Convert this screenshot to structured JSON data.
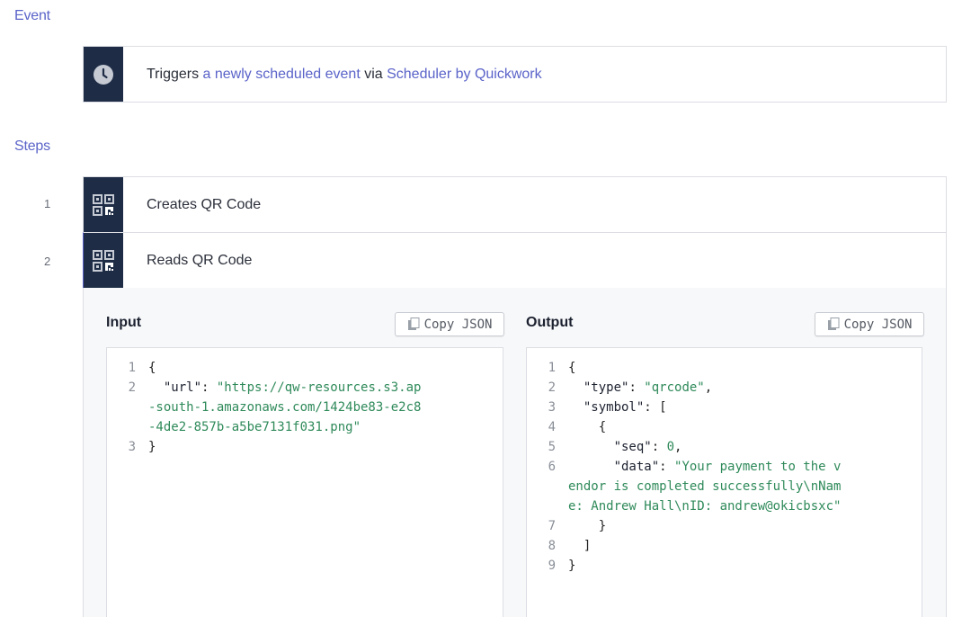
{
  "event_section": {
    "heading": "Event",
    "trigger": {
      "prefix": "Triggers ",
      "event_link": "a newly scheduled event",
      "middle": " via ",
      "app_link": "Scheduler by Quickwork",
      "icon": "clock-icon"
    }
  },
  "steps_section": {
    "heading": "Steps",
    "steps": [
      {
        "number": "1",
        "label": "Creates QR Code",
        "icon": "qr-code-icon"
      },
      {
        "number": "2",
        "label": "Reads QR Code",
        "icon": "qr-code-icon"
      }
    ]
  },
  "detail": {
    "input": {
      "title": "Input",
      "copy_label": "Copy JSON",
      "lines": [
        {
          "n": "1",
          "parts": [
            [
              "p",
              "{"
            ]
          ]
        },
        {
          "n": "2",
          "parts": [
            [
              "p",
              "  "
            ],
            [
              "k",
              "\"url\""
            ],
            [
              "p",
              ": "
            ],
            [
              "s",
              "\"https://qw-resources.s3.ap"
            ]
          ]
        },
        {
          "n": "",
          "parts": [
            [
              "s",
              "-south-1.amazonaws.com/1424be83-e2c8"
            ]
          ]
        },
        {
          "n": "",
          "parts": [
            [
              "s",
              "-4de2-857b-a5be7131f031.png\""
            ]
          ]
        },
        {
          "n": "3",
          "parts": [
            [
              "p",
              "}"
            ]
          ]
        }
      ]
    },
    "output": {
      "title": "Output",
      "copy_label": "Copy JSON",
      "lines": [
        {
          "n": "1",
          "parts": [
            [
              "p",
              "{"
            ]
          ]
        },
        {
          "n": "2",
          "parts": [
            [
              "p",
              "  "
            ],
            [
              "k",
              "\"type\""
            ],
            [
              "p",
              ": "
            ],
            [
              "s",
              "\"qrcode\""
            ],
            [
              "p",
              ","
            ]
          ]
        },
        {
          "n": "3",
          "parts": [
            [
              "p",
              "  "
            ],
            [
              "k",
              "\"symbol\""
            ],
            [
              "p",
              ": ["
            ]
          ]
        },
        {
          "n": "4",
          "parts": [
            [
              "p",
              "    {"
            ]
          ]
        },
        {
          "n": "5",
          "parts": [
            [
              "p",
              "      "
            ],
            [
              "k",
              "\"seq\""
            ],
            [
              "p",
              ": "
            ],
            [
              "m",
              "0"
            ],
            [
              "p",
              ","
            ]
          ]
        },
        {
          "n": "6",
          "parts": [
            [
              "p",
              "      "
            ],
            [
              "k",
              "\"data\""
            ],
            [
              "p",
              ": "
            ],
            [
              "s",
              "\"Your payment to the v"
            ]
          ]
        },
        {
          "n": "",
          "parts": [
            [
              "s",
              "endor is completed successfully\\nNam"
            ]
          ]
        },
        {
          "n": "",
          "parts": [
            [
              "s",
              "e: Andrew Hall\\nID: andrew@okicbsxc\""
            ]
          ]
        },
        {
          "n": "7",
          "parts": [
            [
              "p",
              "    }"
            ]
          ]
        },
        {
          "n": "8",
          "parts": [
            [
              "p",
              "  ]"
            ]
          ]
        },
        {
          "n": "9",
          "parts": [
            [
              "p",
              "}"
            ]
          ]
        }
      ]
    }
  },
  "colors": {
    "accent": "#5b64c9",
    "icon_bg": "#1e2c46",
    "string": "#2f8a5a"
  }
}
